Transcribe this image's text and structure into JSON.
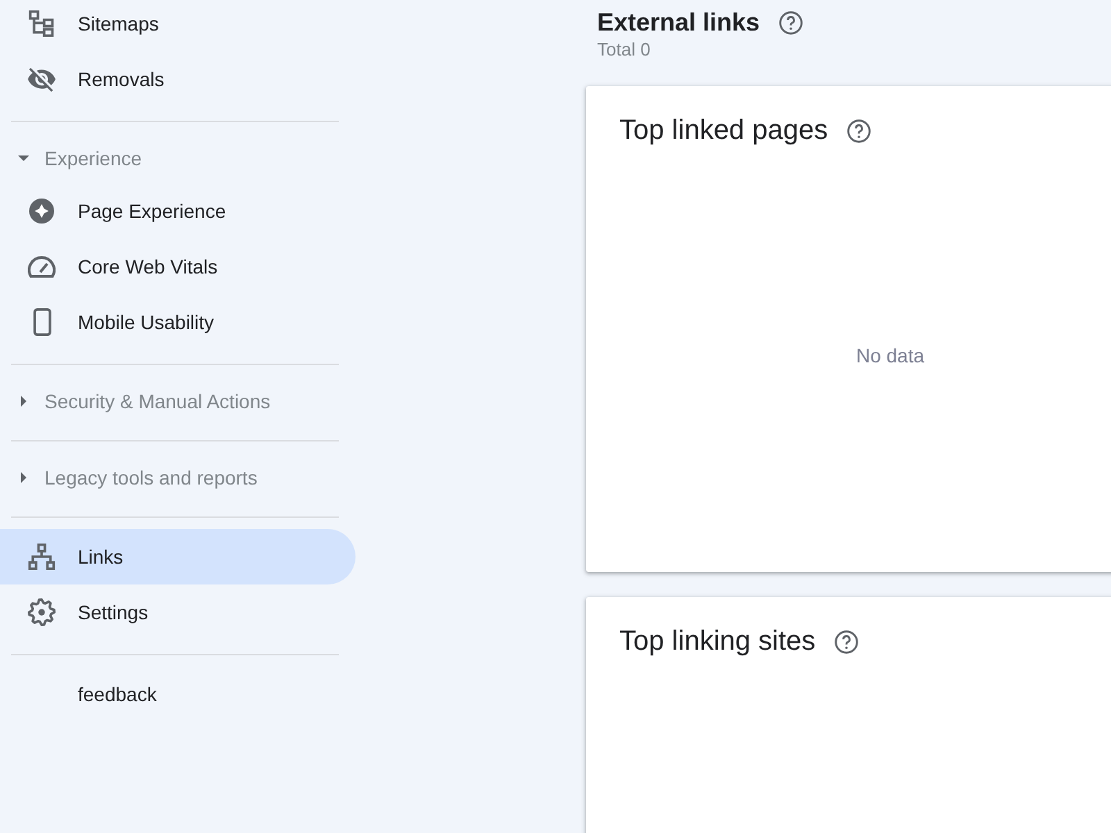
{
  "sidebar": {
    "groups": [
      {
        "items": [
          {
            "kind": "link",
            "label": "Sitemaps",
            "selected": false
          },
          {
            "kind": "link",
            "label": "Removals",
            "selected": false
          }
        ]
      },
      {
        "items": [
          {
            "kind": "section",
            "label": "Experience",
            "expanded": true,
            "children": [
              {
                "label": "Page Experience",
                "selected": false
              },
              {
                "label": "Core Web Vitals",
                "selected": false
              },
              {
                "label": "Mobile Usability",
                "selected": false
              }
            ]
          }
        ]
      },
      {
        "items": [
          {
            "kind": "section",
            "label": "Security & Manual Actions",
            "expanded": false
          }
        ]
      },
      {
        "items": [
          {
            "kind": "section",
            "label": "Legacy tools and reports",
            "expanded": false
          }
        ]
      },
      {
        "items": [
          {
            "kind": "link",
            "label": "Links",
            "selected": true
          },
          {
            "kind": "link",
            "label": "Settings",
            "selected": false
          }
        ]
      },
      {
        "items": [
          {
            "kind": "link",
            "label": "feedback",
            "selected": false
          }
        ]
      }
    ]
  },
  "page_header": {
    "title": "External links",
    "subtitle": "Total 0"
  },
  "cards": [
    {
      "title": "Top linked pages",
      "empty_text": "No data"
    },
    {
      "title": "Top linking sites"
    }
  ]
}
